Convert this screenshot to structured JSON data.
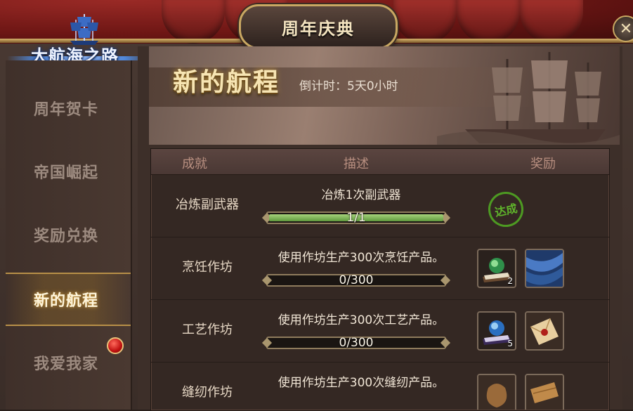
{
  "window": {
    "title": "周年庆典",
    "close_label": "✕"
  },
  "logo": {
    "text": "大航海之路"
  },
  "sidebar": {
    "items": [
      {
        "label": "周年贺卡",
        "active": false
      },
      {
        "label": "帝国崛起",
        "active": false
      },
      {
        "label": "奖励兑换",
        "active": false
      },
      {
        "label": "新的航程",
        "active": true
      },
      {
        "label": "我爱我家",
        "active": false,
        "badge": "red-dot"
      }
    ]
  },
  "banner": {
    "title": "新的航程",
    "countdown": "倒计时：5天0小时"
  },
  "table": {
    "headers": [
      "成就",
      "描述",
      "奖励"
    ],
    "rows": [
      {
        "name": "冶炼副武器",
        "desc": "冶炼1次副武器",
        "progress": "1/1",
        "progress_fraction": 1.0,
        "status": "达成",
        "rewards": []
      },
      {
        "name": "烹饪作坊",
        "desc": "使用作坊生产300次烹饪产品。",
        "progress": "0/300",
        "progress_fraction": 0.0,
        "rewards": [
          {
            "icon": "crystal-ball-book-icon",
            "count": "2"
          },
          {
            "icon": "blue-fabric-icon",
            "count": ""
          }
        ]
      },
      {
        "name": "工艺作坊",
        "desc": "使用作坊生产300次工艺产品。",
        "progress": "0/300",
        "progress_fraction": 0.0,
        "rewards": [
          {
            "icon": "crystal-orb-book-icon",
            "count": "5"
          },
          {
            "icon": "sealed-letter-icon",
            "count": ""
          }
        ]
      },
      {
        "name": "缝纫作坊",
        "desc": "使用作坊生产300次缝纫产品。",
        "progress": "",
        "progress_fraction": 0.0,
        "rewards": [
          {
            "icon": "sack-icon",
            "count": ""
          },
          {
            "icon": "wood-plank-icon",
            "count": ""
          }
        ]
      }
    ]
  },
  "colors": {
    "accent_gold": "#c9a862",
    "progress_green": "#7fb85a",
    "complete_green": "#4d9a22",
    "badge_red": "#c01010"
  }
}
